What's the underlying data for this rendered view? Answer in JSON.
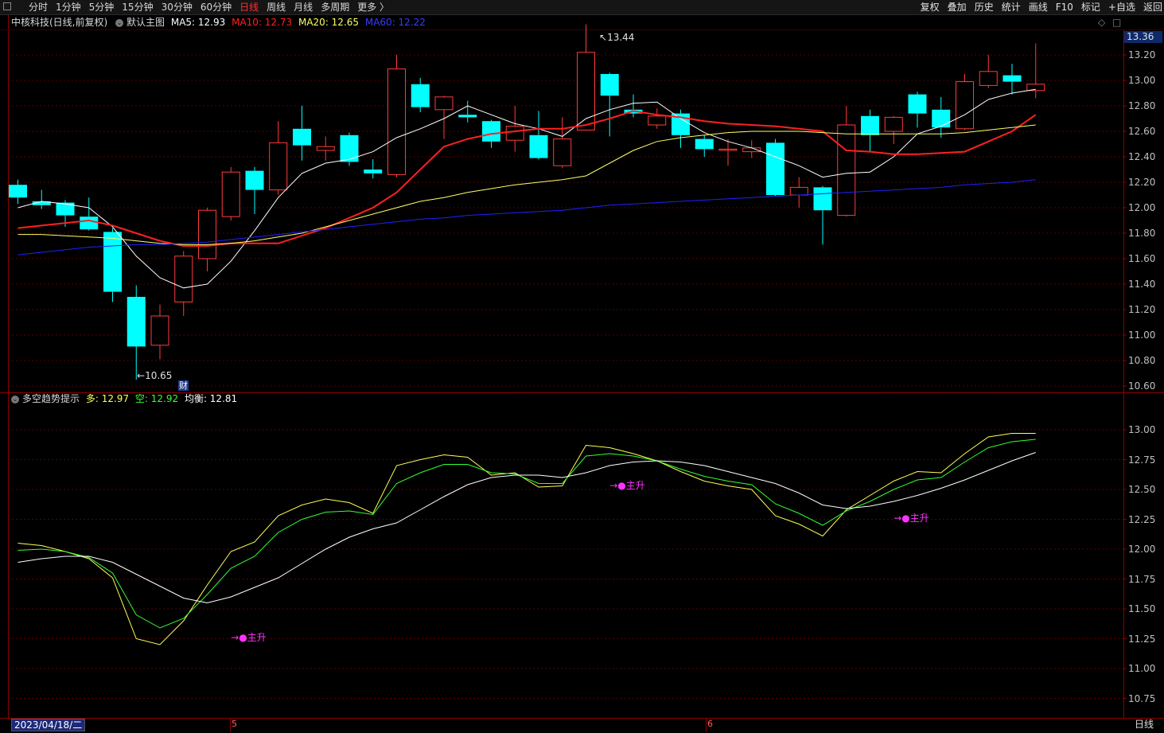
{
  "toolbar": {
    "periods": [
      "分时",
      "1分钟",
      "5分钟",
      "15分钟",
      "30分钟",
      "60分钟",
      "日线",
      "周线",
      "月线",
      "多周期",
      "更多 〉"
    ],
    "active_period": "日线",
    "tools": [
      "复权",
      "叠加",
      "历史",
      "统计",
      "画线",
      "F10",
      "标记",
      "+自选",
      "返回"
    ]
  },
  "main": {
    "title": "中核科技(日线,前复权)",
    "template": "默认主图",
    "ma5": "MA5: 12.93",
    "ma10": "MA10: 12.73",
    "ma20": "MA20: 12.65",
    "ma60": "MA60: 12.22",
    "high_label": "13.44",
    "low_label": "10.65",
    "marker": "财",
    "price_box": "13.36",
    "y_ticks": [
      "13.20",
      "13.00",
      "12.80",
      "12.60",
      "12.40",
      "12.20",
      "12.00",
      "11.80",
      "11.60",
      "11.40",
      "11.20",
      "11.00",
      "10.80",
      "10.60"
    ]
  },
  "sub": {
    "title": "多空趋势提示",
    "bull": "多: 12.97",
    "bear": "空: 12.92",
    "balance": "均衡: 12.81",
    "signal": "主升",
    "y_ticks": [
      "13.00",
      "12.75",
      "12.50",
      "12.25",
      "12.00",
      "11.75",
      "11.50",
      "11.25",
      "11.00",
      "10.75"
    ]
  },
  "bottom": {
    "date": "2023/04/18/二",
    "month_ticks": [
      "5",
      "6"
    ],
    "period": "日线"
  },
  "colors": {
    "up": "#ff3b3b",
    "down": "#00ffff",
    "ma5": "#ffffff",
    "ma10": "#ff2020",
    "ma20": "#ffff66",
    "ma60": "#2020ff",
    "bull_line": "#ffff55",
    "bear_line": "#33ff33",
    "balance_line": "#ffffff",
    "signal": "#ff33ff"
  },
  "chart_data": [
    {
      "type": "candlestick",
      "title": "中核科技(日线,前复权)",
      "ylim": [
        10.55,
        13.4
      ],
      "candles": [
        {
          "o": 12.18,
          "h": 12.22,
          "l": 12.03,
          "c": 12.08
        },
        {
          "o": 12.05,
          "h": 12.14,
          "l": 11.99,
          "c": 12.02
        },
        {
          "o": 12.04,
          "h": 12.06,
          "l": 11.85,
          "c": 11.94
        },
        {
          "o": 11.93,
          "h": 12.08,
          "l": 11.82,
          "c": 11.83
        },
        {
          "o": 11.81,
          "h": 11.84,
          "l": 11.26,
          "c": 11.34
        },
        {
          "o": 11.3,
          "h": 11.39,
          "l": 10.65,
          "c": 10.91
        },
        {
          "o": 10.92,
          "h": 11.24,
          "l": 10.81,
          "c": 11.15
        },
        {
          "o": 11.26,
          "h": 11.66,
          "l": 11.15,
          "c": 11.62
        },
        {
          "o": 11.6,
          "h": 12.0,
          "l": 11.5,
          "c": 11.98
        },
        {
          "o": 11.93,
          "h": 12.32,
          "l": 11.9,
          "c": 12.28
        },
        {
          "o": 12.29,
          "h": 12.32,
          "l": 11.95,
          "c": 12.14
        },
        {
          "o": 12.14,
          "h": 12.68,
          "l": 12.1,
          "c": 12.51
        },
        {
          "o": 12.62,
          "h": 12.8,
          "l": 12.37,
          "c": 12.49
        },
        {
          "o": 12.45,
          "h": 12.56,
          "l": 12.37,
          "c": 12.48
        },
        {
          "o": 12.57,
          "h": 12.59,
          "l": 12.33,
          "c": 12.36
        },
        {
          "o": 12.3,
          "h": 12.38,
          "l": 12.23,
          "c": 12.27
        },
        {
          "o": 12.26,
          "h": 13.2,
          "l": 12.24,
          "c": 13.09
        },
        {
          "o": 12.97,
          "h": 13.02,
          "l": 12.75,
          "c": 12.79
        },
        {
          "o": 12.77,
          "h": 12.88,
          "l": 12.54,
          "c": 12.87
        },
        {
          "o": 12.73,
          "h": 12.84,
          "l": 12.67,
          "c": 12.71
        },
        {
          "o": 12.68,
          "h": 12.69,
          "l": 12.47,
          "c": 12.52
        },
        {
          "o": 12.53,
          "h": 12.8,
          "l": 12.44,
          "c": 12.64
        },
        {
          "o": 12.57,
          "h": 12.76,
          "l": 12.38,
          "c": 12.39
        },
        {
          "o": 12.33,
          "h": 12.71,
          "l": 12.31,
          "c": 12.54
        },
        {
          "o": 12.61,
          "h": 13.44,
          "l": 12.61,
          "c": 13.22
        },
        {
          "o": 13.05,
          "h": 13.06,
          "l": 12.56,
          "c": 12.88
        },
        {
          "o": 12.77,
          "h": 12.89,
          "l": 12.71,
          "c": 12.74
        },
        {
          "o": 12.65,
          "h": 12.78,
          "l": 12.62,
          "c": 12.72
        },
        {
          "o": 12.74,
          "h": 12.77,
          "l": 12.47,
          "c": 12.57
        },
        {
          "o": 12.54,
          "h": 12.57,
          "l": 12.4,
          "c": 12.46
        },
        {
          "o": 12.46,
          "h": 12.54,
          "l": 12.33,
          "c": 12.46
        },
        {
          "o": 12.44,
          "h": 12.53,
          "l": 12.39,
          "c": 12.47
        },
        {
          "o": 12.51,
          "h": 12.54,
          "l": 12.09,
          "c": 12.1
        },
        {
          "o": 12.1,
          "h": 12.24,
          "l": 12.0,
          "c": 12.16
        },
        {
          "o": 12.16,
          "h": 12.17,
          "l": 11.71,
          "c": 11.98
        },
        {
          "o": 11.94,
          "h": 12.8,
          "l": 11.93,
          "c": 12.65
        },
        {
          "o": 12.72,
          "h": 12.77,
          "l": 12.44,
          "c": 12.57
        },
        {
          "o": 12.6,
          "h": 12.72,
          "l": 12.5,
          "c": 12.71
        },
        {
          "o": 12.89,
          "h": 12.91,
          "l": 12.63,
          "c": 12.74
        },
        {
          "o": 12.77,
          "h": 12.87,
          "l": 12.55,
          "c": 12.63
        },
        {
          "o": 12.62,
          "h": 13.05,
          "l": 12.61,
          "c": 12.99
        },
        {
          "o": 12.96,
          "h": 13.2,
          "l": 12.94,
          "c": 13.07
        },
        {
          "o": 13.04,
          "h": 13.13,
          "l": 12.89,
          "c": 12.99
        },
        {
          "o": 12.92,
          "h": 13.29,
          "l": 12.86,
          "c": 12.97
        }
      ],
      "series": [
        {
          "name": "MA5",
          "values": [
            12.0,
            12.05,
            12.03,
            12.0,
            11.85,
            11.62,
            11.45,
            11.37,
            11.4,
            11.58,
            11.82,
            12.08,
            12.27,
            12.35,
            12.38,
            12.44,
            12.55,
            12.62,
            12.7,
            12.8,
            12.73,
            12.66,
            12.62,
            12.56,
            12.7,
            12.77,
            12.82,
            12.83,
            12.7,
            12.59,
            12.52,
            12.47,
            12.4,
            12.33,
            12.24,
            12.27,
            12.28,
            12.4,
            12.58,
            12.64,
            12.73,
            12.85,
            12.9,
            12.93
          ]
        },
        {
          "name": "MA10",
          "values": [
            11.84,
            11.86,
            11.88,
            11.9,
            11.86,
            11.8,
            11.74,
            11.7,
            11.7,
            11.72,
            11.72,
            11.72,
            11.78,
            11.84,
            11.92,
            12.0,
            12.12,
            12.3,
            12.48,
            12.54,
            12.58,
            12.6,
            12.62,
            12.62,
            12.65,
            12.7,
            12.76,
            12.73,
            12.71,
            12.68,
            12.66,
            12.65,
            12.64,
            12.62,
            12.6,
            12.45,
            12.44,
            12.42,
            12.42,
            12.43,
            12.44,
            12.52,
            12.6,
            12.73
          ]
        },
        {
          "name": "MA20",
          "values": [
            11.79,
            11.79,
            11.78,
            11.77,
            11.76,
            11.74,
            11.72,
            11.71,
            11.71,
            11.72,
            11.74,
            11.77,
            11.8,
            11.85,
            11.9,
            11.95,
            12.0,
            12.05,
            12.08,
            12.12,
            12.15,
            12.18,
            12.2,
            12.22,
            12.25,
            12.35,
            12.45,
            12.52,
            12.55,
            12.57,
            12.59,
            12.6,
            12.6,
            12.6,
            12.59,
            12.58,
            12.58,
            12.58,
            12.58,
            12.58,
            12.59,
            12.61,
            12.63,
            12.65
          ]
        },
        {
          "name": "MA60",
          "values": [
            11.63,
            11.65,
            11.67,
            11.69,
            11.7,
            11.71,
            11.71,
            11.72,
            11.73,
            11.75,
            11.77,
            11.79,
            11.81,
            11.83,
            11.85,
            11.87,
            11.89,
            11.91,
            11.92,
            11.94,
            11.95,
            11.96,
            11.97,
            11.98,
            12.0,
            12.02,
            12.03,
            12.04,
            12.05,
            12.06,
            12.07,
            12.08,
            12.09,
            12.1,
            12.11,
            12.12,
            12.13,
            12.14,
            12.15,
            12.16,
            12.18,
            12.19,
            12.2,
            12.22
          ]
        }
      ]
    },
    {
      "type": "line",
      "title": "多空趋势提示",
      "ylim": [
        10.6,
        13.2
      ],
      "series": [
        {
          "name": "多",
          "values": [
            12.05,
            12.03,
            11.98,
            11.92,
            11.76,
            11.25,
            11.2,
            11.4,
            11.7,
            11.98,
            12.06,
            12.28,
            12.37,
            12.42,
            12.39,
            12.3,
            12.7,
            12.75,
            12.79,
            12.77,
            12.62,
            12.64,
            12.52,
            12.53,
            12.87,
            12.85,
            12.8,
            12.74,
            12.65,
            12.57,
            12.53,
            12.5,
            12.28,
            12.21,
            12.11,
            12.33,
            12.45,
            12.57,
            12.65,
            12.64,
            12.8,
            12.94,
            12.97,
            12.97
          ]
        },
        {
          "name": "空",
          "values": [
            11.99,
            12.0,
            11.98,
            11.93,
            11.8,
            11.45,
            11.34,
            11.42,
            11.62,
            11.84,
            11.94,
            12.14,
            12.25,
            12.31,
            12.32,
            12.29,
            12.55,
            12.64,
            12.71,
            12.71,
            12.64,
            12.63,
            12.55,
            12.55,
            12.78,
            12.8,
            12.78,
            12.74,
            12.67,
            12.61,
            12.57,
            12.54,
            12.38,
            12.3,
            12.2,
            12.32,
            12.4,
            12.5,
            12.58,
            12.6,
            12.73,
            12.85,
            12.9,
            12.92
          ]
        },
        {
          "name": "均衡",
          "values": [
            11.89,
            11.92,
            11.94,
            11.94,
            11.89,
            11.79,
            11.69,
            11.59,
            11.55,
            11.6,
            11.68,
            11.76,
            11.88,
            12.0,
            12.1,
            12.17,
            12.22,
            12.33,
            12.44,
            12.54,
            12.6,
            12.62,
            12.62,
            12.6,
            12.64,
            12.7,
            12.73,
            12.74,
            12.73,
            12.7,
            12.65,
            12.6,
            12.55,
            12.47,
            12.37,
            12.34,
            12.36,
            12.4,
            12.45,
            12.51,
            12.58,
            12.66,
            12.74,
            12.81
          ]
        }
      ],
      "signals": [
        {
          "label": "主升",
          "index": 9
        },
        {
          "label": "主升",
          "index": 25
        },
        {
          "label": "主升",
          "index": 37
        }
      ]
    }
  ]
}
